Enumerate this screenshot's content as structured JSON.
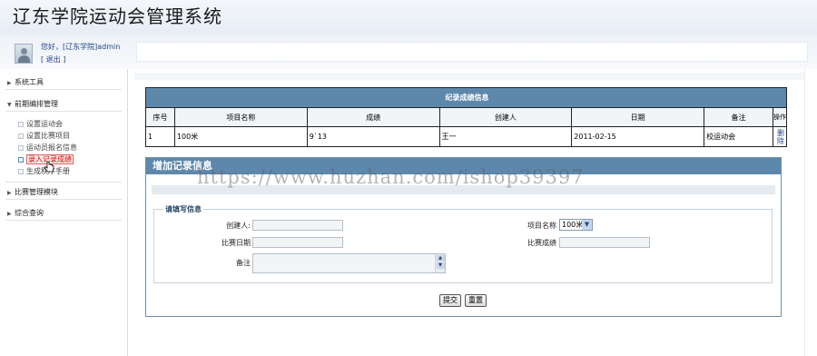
{
  "app": {
    "title": "辽东学院运动会管理系统"
  },
  "user": {
    "welcome": "您好，[辽东学院]admin",
    "logout": "[ 退出 ]"
  },
  "sidebar": {
    "groups": [
      {
        "label": "系统工具"
      },
      {
        "label": "前期编排管理"
      },
      {
        "label": "比赛管理模块"
      },
      {
        "label": "综合查询"
      }
    ],
    "items": [
      {
        "label": "设置运动会"
      },
      {
        "label": "设置比赛项目"
      },
      {
        "label": "运动员报名信息"
      },
      {
        "label": "录入记录成绩"
      },
      {
        "label": "生成秩序手册"
      }
    ]
  },
  "records": {
    "title": "纪录成绩信息",
    "columns": [
      "序号",
      "项目名称",
      "成绩",
      "创建人",
      "日期",
      "备注",
      "操作"
    ],
    "rows": [
      {
        "no": "1",
        "event": "100米",
        "score": "9`13",
        "creator": "王一",
        "date": "2011-02-15",
        "note": "校运动会",
        "action": "删除"
      }
    ]
  },
  "form": {
    "title": "增加记录信息",
    "legend": "请填写信息",
    "creator_label": "创建人:",
    "event_label": "项目名称",
    "event_value": "100米",
    "date_label": "比赛日期",
    "score_label": "比赛成绩",
    "note_label": "备注",
    "submit": "提交",
    "reset": "重置"
  },
  "watermark": "https://www.huzhan.com/ishop39397",
  "colors": {
    "accent": "#5e88ab",
    "active": "#d10000"
  }
}
